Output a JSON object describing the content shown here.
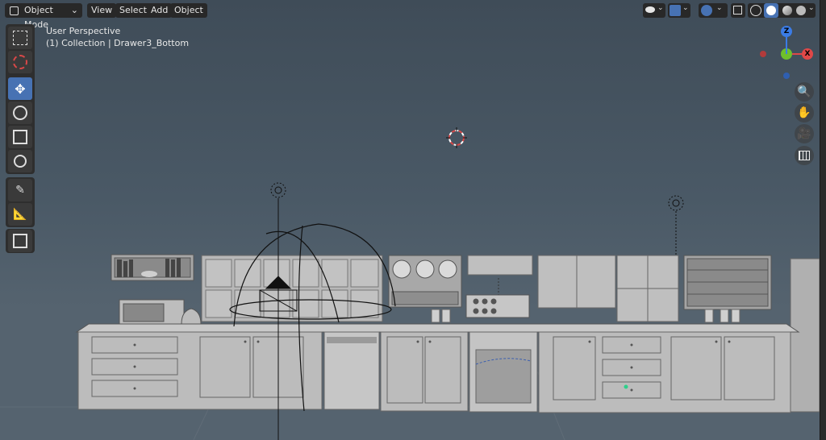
{
  "header": {
    "mode_label": "Object Mode",
    "menus": [
      "View",
      "Select",
      "Add",
      "Object"
    ]
  },
  "overlay": {
    "perspective": "User Perspective",
    "context": "(1) Collection | Drawer3_Bottom"
  },
  "gizmo": {
    "z_label": "Z",
    "x_label": "X",
    "colors": {
      "x": "#e04848",
      "y": "#6ec02c",
      "z": "#3b7ce6"
    }
  },
  "toolbar": {
    "tools": [
      "select-box",
      "cursor",
      "move",
      "rotate",
      "scale",
      "transform",
      "annotate",
      "measure",
      "add-cube"
    ],
    "active": "move"
  },
  "navigation": [
    "zoom-icon",
    "pan-hand-icon",
    "camera-icon",
    "perspective-grid-icon"
  ],
  "colors": {
    "accent": "#4772b3",
    "header_button": "#282828",
    "viewport_top": "#3f4c58",
    "viewport_bottom": "#55636f"
  }
}
